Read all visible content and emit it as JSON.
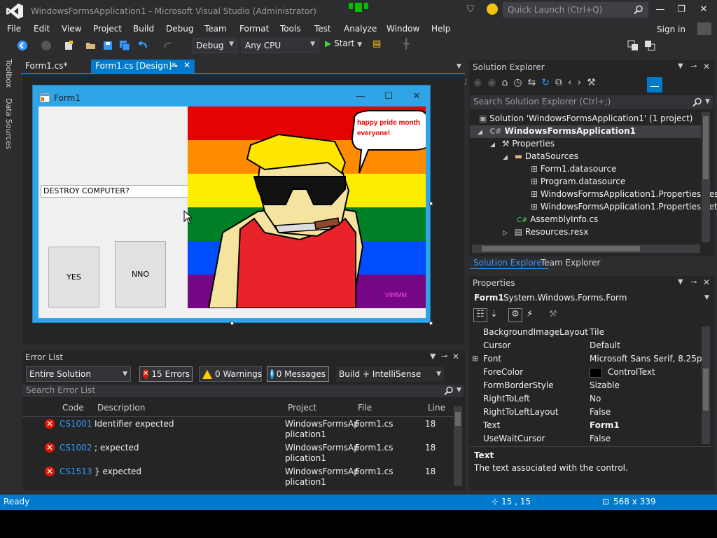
{
  "window": {
    "title": "WindowsFormsApplication1 - Microsoft Visual Studio (Administrator)",
    "quick_launch_placeholder": "Quick Launch (Ctrl+Q)",
    "minimize": "—",
    "maximize": "❐",
    "close": "✕"
  },
  "menu": {
    "items": [
      "File",
      "Edit",
      "View",
      "Project",
      "Build",
      "Debug",
      "Team",
      "Format",
      "Tools",
      "Test",
      "Analyze",
      "Window",
      "Help"
    ],
    "sign_in": "Sign in"
  },
  "toolbar": {
    "config": "Debug",
    "platform": "Any CPU",
    "start_label": "Start"
  },
  "left_tabs": [
    "Toolbox",
    "Data Sources"
  ],
  "doc_tabs": [
    {
      "label": "Form1.cs*",
      "active": false
    },
    {
      "label": "Form1.cs [Design]*",
      "active": true
    }
  ],
  "form": {
    "title": "Form1",
    "textbox_value": "DESTROY COMPUTER?",
    "yes_label": "YES",
    "no_label": "NNO",
    "speech_bubble": "happy pride month everyone!",
    "signature": "VIMMM"
  },
  "error_list": {
    "title": "Error List",
    "scope": "Entire Solution",
    "errors_label": "15 Errors",
    "warnings_label": "0 Warnings",
    "messages_label": "0 Messages",
    "source": "Build + IntelliSense",
    "search_placeholder": "Search Error List",
    "columns": [
      "Code",
      "Description",
      "Project",
      "File",
      "Line"
    ],
    "rows": [
      {
        "code": "CS1001",
        "description": "Identifier expected",
        "project_1": "WindowsFormsAp",
        "project_2": "plication1",
        "file": "Form1.cs",
        "line": "18"
      },
      {
        "code": "CS1002",
        "description": "; expected",
        "project_1": "WindowsFormsAp",
        "project_2": "plication1",
        "file": "Form1.cs",
        "line": "18"
      },
      {
        "code": "CS1513",
        "description": "} expected",
        "project_1": "WindowsFormsAp",
        "project_2": "plication1",
        "file": "Form1.cs",
        "line": "18"
      }
    ]
  },
  "solution_explorer": {
    "title": "Solution Explorer",
    "search_placeholder": "Search Solution Explorer (Ctrl+;)",
    "items": [
      {
        "label": "Solution 'WindowsFormsApplication1' (1 project)",
        "indent": 0,
        "icon": "solution-icon",
        "expander": ""
      },
      {
        "label": "WindowsFormsApplication1",
        "indent": 1,
        "icon": "csharp-project-icon",
        "expander": "◢",
        "bold": true
      },
      {
        "label": "Properties",
        "indent": 2,
        "icon": "wrench-icon",
        "expander": "◢"
      },
      {
        "label": "DataSources",
        "indent": 3,
        "icon": "folder-icon",
        "expander": "◢"
      },
      {
        "label": "Form1.datasource",
        "indent": 4,
        "icon": "datasource-icon",
        "expander": ""
      },
      {
        "label": "Program.datasource",
        "indent": 4,
        "icon": "datasource-icon",
        "expander": ""
      },
      {
        "label": "WindowsFormsApplication1.Properties.Res",
        "indent": 4,
        "icon": "datasource-icon",
        "expander": ""
      },
      {
        "label": "WindowsFormsApplication1.Properties.Set",
        "indent": 4,
        "icon": "datasource-icon",
        "expander": ""
      },
      {
        "label": "AssemblyInfo.cs",
        "indent": 3,
        "icon": "csharp-file-icon",
        "expander": ""
      },
      {
        "label": "Resources.resx",
        "indent": 3,
        "icon": "resx-icon",
        "expander": "▷"
      }
    ],
    "tab_solution": "Solution Explorer",
    "tab_team": "Team Explorer"
  },
  "properties": {
    "title": "Properties",
    "object_name": "Form1",
    "object_type": "System.Windows.Forms.Form",
    "rows": [
      {
        "name": "BackgroundImageLayout",
        "value": "Tile"
      },
      {
        "name": "Cursor",
        "value": "Default"
      },
      {
        "name": "Font",
        "value": "Microsoft Sans Serif, 8.25pt",
        "expandable": true
      },
      {
        "name": "ForeColor",
        "value": "ControlText",
        "swatch": "#000000"
      },
      {
        "name": "FormBorderStyle",
        "value": "Sizable"
      },
      {
        "name": "RightToLeft",
        "value": "No"
      },
      {
        "name": "RightToLeftLayout",
        "value": "False"
      },
      {
        "name": "Text",
        "value": "Form1",
        "bold": true
      },
      {
        "name": "UseWaitCursor",
        "value": "False"
      }
    ],
    "desc_title": "Text",
    "desc_text": "The text associated with the control."
  },
  "status": {
    "text": "Ready",
    "position": "15 , 15",
    "size": "568 x 339"
  },
  "colors": {
    "accent": "#007acc",
    "form_border": "#2fa4e7",
    "error": "#e51400",
    "link": "#3399ff"
  }
}
